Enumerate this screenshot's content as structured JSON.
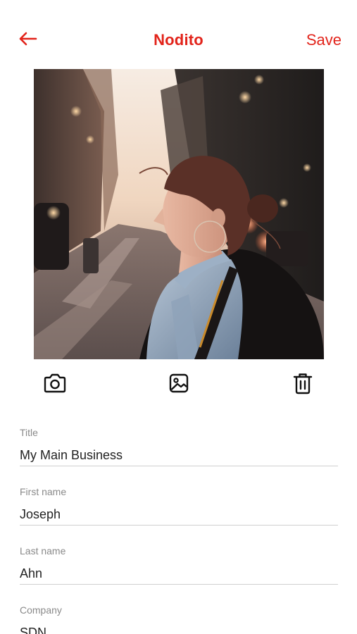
{
  "header": {
    "title": "Nodito",
    "save_label": "Save",
    "back_icon": "arrow-left-icon"
  },
  "colors": {
    "accent": "#e2231a",
    "label": "#8a8a8a",
    "divider": "#cfcfcf"
  },
  "photo": {
    "icon": "profile-photo"
  },
  "photo_actions": {
    "camera_icon": "camera-icon",
    "gallery_icon": "image-icon",
    "delete_icon": "trash-icon"
  },
  "form": {
    "fields": [
      {
        "label": "Title",
        "value": "My Main Business"
      },
      {
        "label": "First name",
        "value": "Joseph"
      },
      {
        "label": "Last name",
        "value": "Ahn"
      },
      {
        "label": "Company",
        "value": "SDN"
      }
    ]
  }
}
